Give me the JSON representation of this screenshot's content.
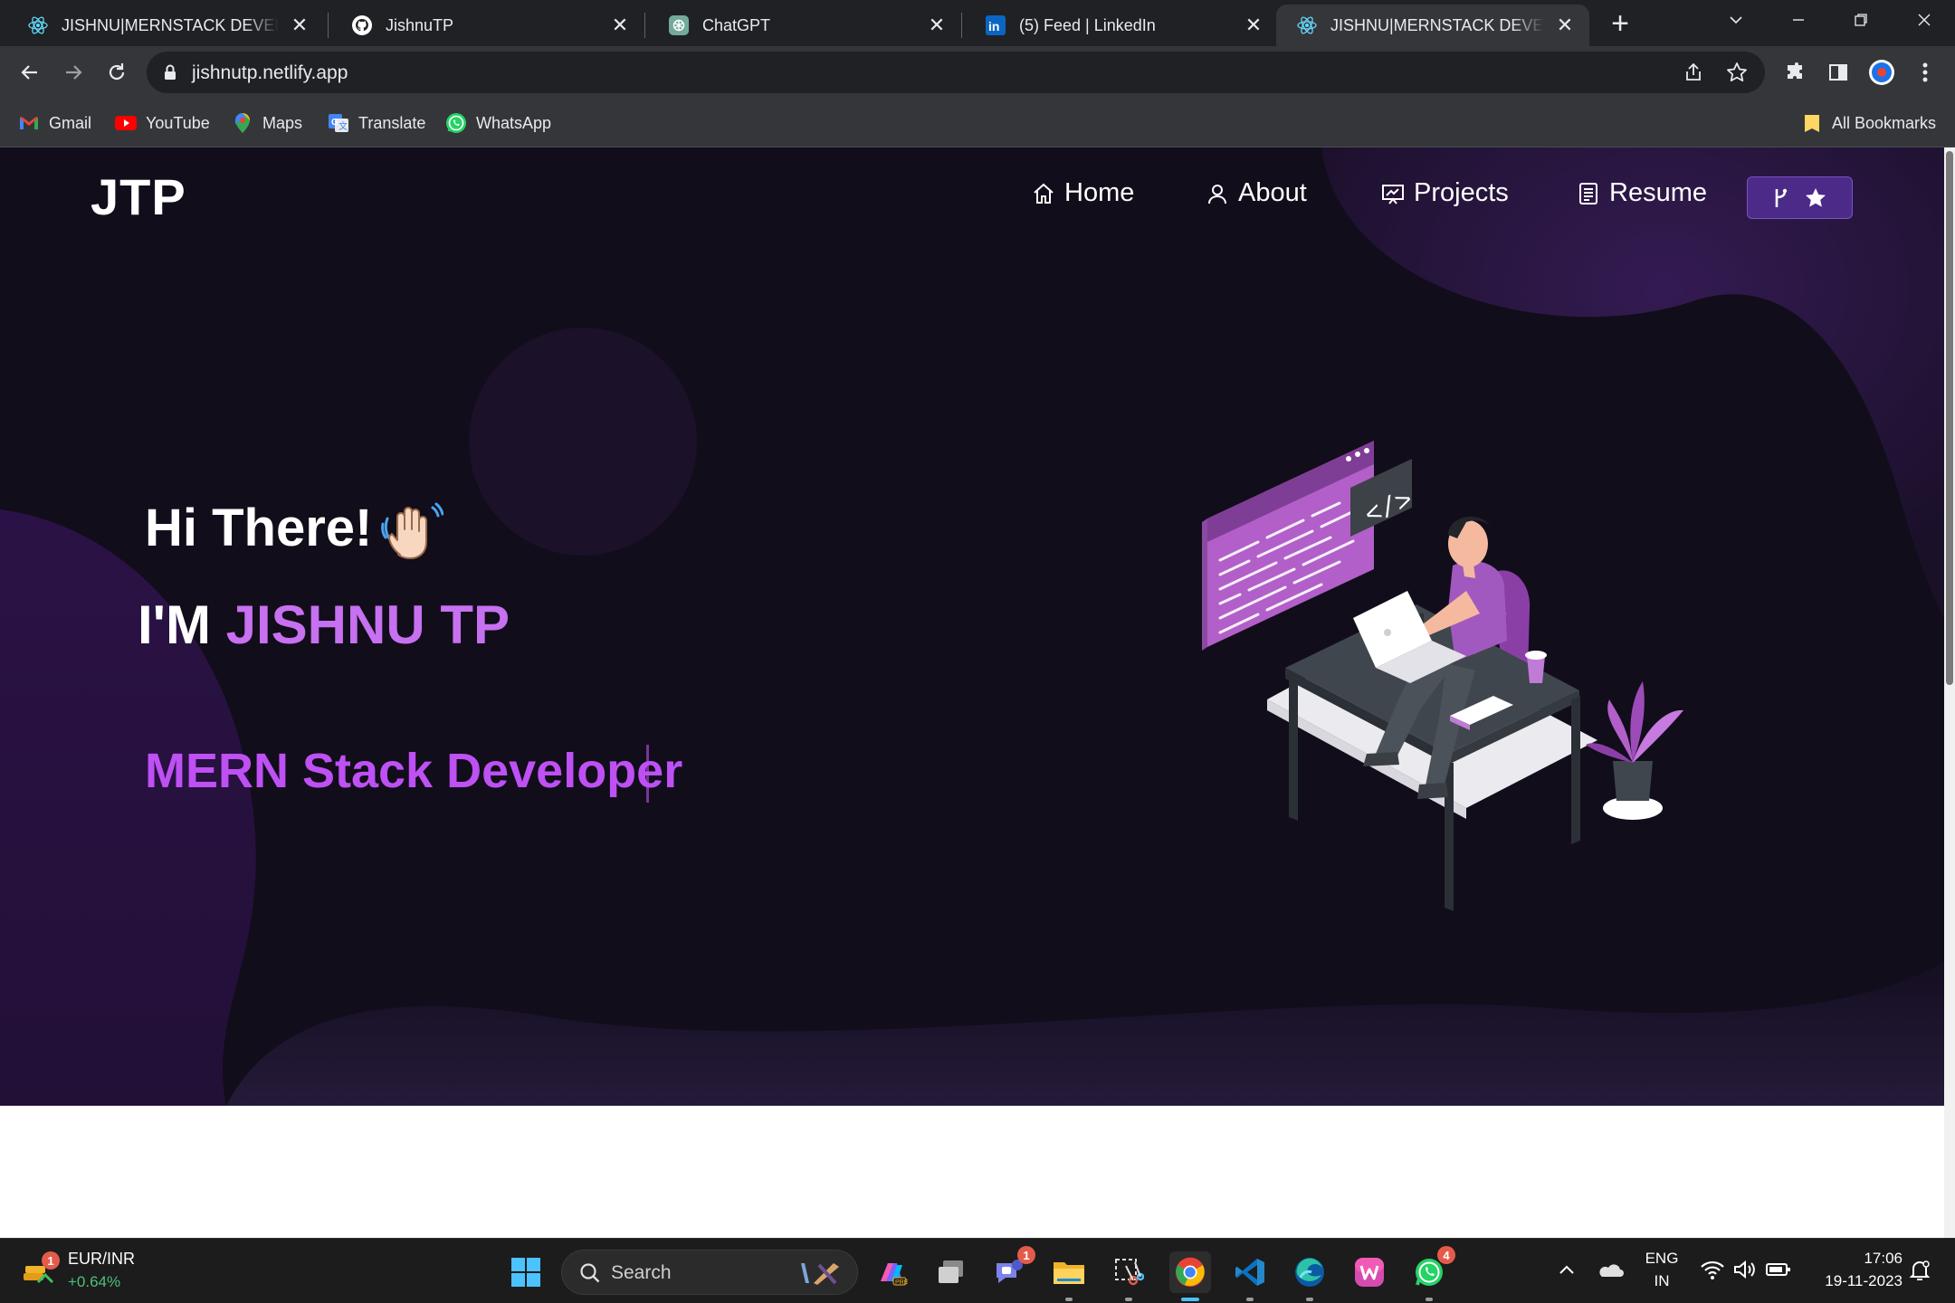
{
  "browser": {
    "tabs": [
      {
        "title": "JISHNU|MERNSTACK DEVELOPER",
        "favicon": "react-icon",
        "active": false
      },
      {
        "title": "JishnuTP",
        "favicon": "github-icon",
        "active": false
      },
      {
        "title": "ChatGPT",
        "favicon": "chatgpt-icon",
        "active": false
      },
      {
        "title": "(5) Feed | LinkedIn",
        "favicon": "linkedin-icon",
        "active": false
      },
      {
        "title": "JISHNU|MERNSTACK DEVELOPER",
        "favicon": "react-icon",
        "active": true
      }
    ],
    "new_tab_label": "+",
    "url": "jishnutp.netlify.app",
    "bookmarks": [
      {
        "label": "Gmail",
        "icon": "gmail-icon"
      },
      {
        "label": "YouTube",
        "icon": "youtube-icon"
      },
      {
        "label": "Maps",
        "icon": "maps-icon"
      },
      {
        "label": "Translate",
        "icon": "translate-icon"
      },
      {
        "label": "WhatsApp",
        "icon": "whatsapp-icon"
      }
    ],
    "all_bookmarks_label": "All Bookmarks"
  },
  "site": {
    "logo": "JTP",
    "nav": [
      {
        "label": "Home",
        "icon": "home-icon"
      },
      {
        "label": "About",
        "icon": "user-icon"
      },
      {
        "label": "Projects",
        "icon": "projects-icon"
      },
      {
        "label": "Resume",
        "icon": "document-icon"
      }
    ],
    "github_button_icons": [
      "git-fork-icon",
      "star-icon"
    ],
    "greeting": "Hi There!",
    "greeting_emoji": "waving-hand-icon",
    "intro_prefix": "I'M ",
    "intro_name": "JISHNU TP",
    "role": "MERN Stack Developer",
    "colors": {
      "background": "#110d1a",
      "accent": "#c770f0",
      "role": "#be50f4",
      "blob": "#2a1547",
      "button": "#4b2a88"
    }
  },
  "taskbar": {
    "widget": {
      "title": "EUR/INR",
      "change": "+0.64%",
      "badge": "1"
    },
    "search_placeholder": "Search",
    "apps": [
      {
        "name": "windows-start-icon"
      },
      {
        "name": "copilot-icon"
      },
      {
        "name": "task-view-icon"
      },
      {
        "name": "teams-icon",
        "badge": "1"
      },
      {
        "name": "file-explorer-icon"
      },
      {
        "name": "snipping-tool-icon"
      },
      {
        "name": "chrome-icon",
        "active": true
      },
      {
        "name": "vscode-icon"
      },
      {
        "name": "edge-icon"
      },
      {
        "name": "office-icon"
      },
      {
        "name": "whatsapp-icon",
        "badge": "4"
      }
    ],
    "language": "ENG",
    "region": "IN",
    "time": "17:06",
    "date": "19-11-2023"
  }
}
